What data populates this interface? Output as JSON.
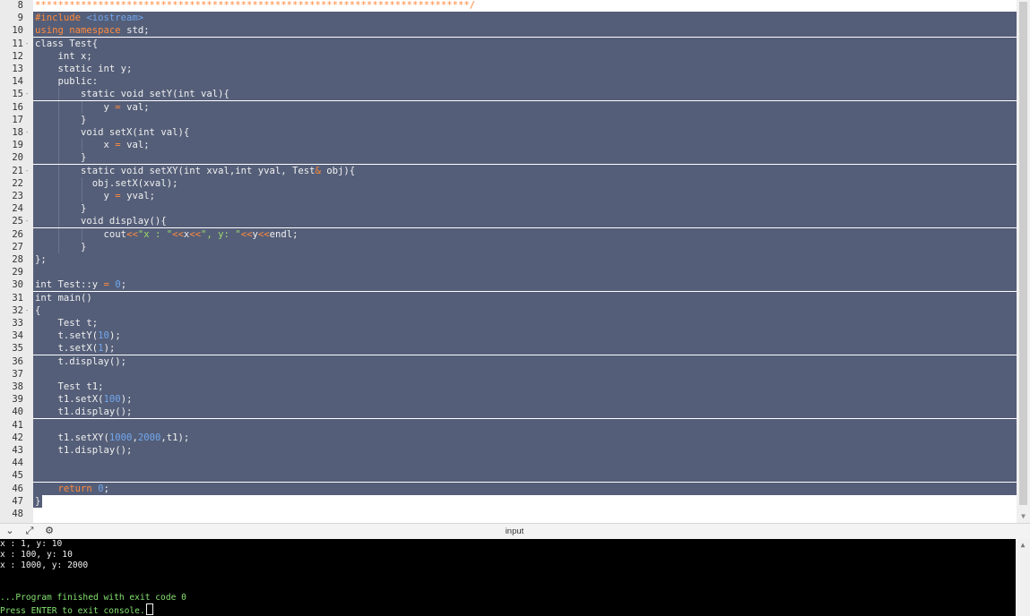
{
  "editor": {
    "lines": [
      {
        "n": "8",
        "fold": "",
        "segs": [
          {
            "t": "****************************************************************************/",
            "c": "org"
          }
        ]
      },
      {
        "n": "9",
        "fold": "",
        "segs": [
          {
            "t": "#include ",
            "c": "org"
          },
          {
            "t": "<iostream>",
            "c": "blu"
          }
        ]
      },
      {
        "n": "10",
        "fold": "",
        "segs": [
          {
            "t": "using namespace ",
            "c": "org"
          },
          {
            "t": "std;",
            "c": ""
          }
        ]
      },
      {
        "n": "11",
        "fold": "-",
        "segs": [
          {
            "t": "class Test{",
            "c": ""
          }
        ]
      },
      {
        "n": "12",
        "fold": "",
        "segs": [
          {
            "t": "    int x;",
            "c": ""
          }
        ]
      },
      {
        "n": "13",
        "fold": "",
        "segs": [
          {
            "t": "    static int y;",
            "c": ""
          }
        ]
      },
      {
        "n": "14",
        "fold": "",
        "segs": [
          {
            "t": "    public:",
            "c": ""
          }
        ]
      },
      {
        "n": "15",
        "fold": "-",
        "segs": [
          {
            "t": "        static void setY(int val){",
            "c": ""
          }
        ]
      },
      {
        "n": "16",
        "fold": "",
        "segs": [
          {
            "t": "            y ",
            "c": ""
          },
          {
            "t": "=",
            "c": "org"
          },
          {
            "t": " val;",
            "c": ""
          }
        ]
      },
      {
        "n": "17",
        "fold": "",
        "segs": [
          {
            "t": "        }",
            "c": ""
          }
        ]
      },
      {
        "n": "18",
        "fold": "-",
        "segs": [
          {
            "t": "        void setX(int val){",
            "c": ""
          }
        ]
      },
      {
        "n": "19",
        "fold": "",
        "segs": [
          {
            "t": "            x ",
            "c": ""
          },
          {
            "t": "=",
            "c": "org"
          },
          {
            "t": " val;",
            "c": ""
          }
        ]
      },
      {
        "n": "20",
        "fold": "",
        "segs": [
          {
            "t": "        }",
            "c": ""
          }
        ]
      },
      {
        "n": "21",
        "fold": "-",
        "segs": [
          {
            "t": "        static void setXY(int xval,int yval, Test",
            "c": ""
          },
          {
            "t": "&",
            "c": "org"
          },
          {
            "t": " obj){",
            "c": ""
          }
        ]
      },
      {
        "n": "22",
        "fold": "",
        "segs": [
          {
            "t": "          obj.setX(xval);",
            "c": ""
          }
        ]
      },
      {
        "n": "23",
        "fold": "",
        "segs": [
          {
            "t": "            y ",
            "c": ""
          },
          {
            "t": "=",
            "c": "org"
          },
          {
            "t": " yval;",
            "c": ""
          }
        ]
      },
      {
        "n": "24",
        "fold": "",
        "segs": [
          {
            "t": "        }",
            "c": ""
          }
        ]
      },
      {
        "n": "25",
        "fold": "-",
        "segs": [
          {
            "t": "        void display(){",
            "c": ""
          }
        ]
      },
      {
        "n": "26",
        "fold": "",
        "segs": [
          {
            "t": "            cout",
            "c": ""
          },
          {
            "t": "<<",
            "c": "org"
          },
          {
            "t": "\"x : \"",
            "c": "grn"
          },
          {
            "t": "<<",
            "c": "org"
          },
          {
            "t": "x",
            "c": ""
          },
          {
            "t": "<<",
            "c": "org"
          },
          {
            "t": "\", y: \"",
            "c": "grn"
          },
          {
            "t": "<<",
            "c": "org"
          },
          {
            "t": "y",
            "c": ""
          },
          {
            "t": "<<",
            "c": "org"
          },
          {
            "t": "endl;",
            "c": ""
          }
        ]
      },
      {
        "n": "27",
        "fold": "",
        "segs": [
          {
            "t": "        }",
            "c": ""
          }
        ]
      },
      {
        "n": "28",
        "fold": "",
        "segs": [
          {
            "t": "};",
            "c": ""
          }
        ]
      },
      {
        "n": "29",
        "fold": "",
        "segs": []
      },
      {
        "n": "30",
        "fold": "",
        "segs": [
          {
            "t": "int Test::y ",
            "c": ""
          },
          {
            "t": "=",
            "c": "org"
          },
          {
            "t": " ",
            "c": ""
          },
          {
            "t": "0",
            "c": "blu"
          },
          {
            "t": ";",
            "c": ""
          }
        ]
      },
      {
        "n": "31",
        "fold": "",
        "segs": [
          {
            "t": "int main()",
            "c": ""
          }
        ]
      },
      {
        "n": "32",
        "fold": "-",
        "segs": [
          {
            "t": "{",
            "c": ""
          }
        ]
      },
      {
        "n": "33",
        "fold": "",
        "segs": [
          {
            "t": "    Test t;",
            "c": ""
          }
        ]
      },
      {
        "n": "34",
        "fold": "",
        "segs": [
          {
            "t": "    t.setY(",
            "c": ""
          },
          {
            "t": "10",
            "c": "blu"
          },
          {
            "t": ");",
            "c": ""
          }
        ]
      },
      {
        "n": "35",
        "fold": "",
        "segs": [
          {
            "t": "    t.setX(",
            "c": ""
          },
          {
            "t": "1",
            "c": "blu"
          },
          {
            "t": ");",
            "c": ""
          }
        ]
      },
      {
        "n": "36",
        "fold": "",
        "segs": [
          {
            "t": "    t.display();",
            "c": ""
          }
        ]
      },
      {
        "n": "37",
        "fold": "",
        "segs": []
      },
      {
        "n": "38",
        "fold": "",
        "segs": [
          {
            "t": "    Test t1;",
            "c": ""
          }
        ]
      },
      {
        "n": "39",
        "fold": "",
        "segs": [
          {
            "t": "    t1.setX(",
            "c": ""
          },
          {
            "t": "100",
            "c": "blu"
          },
          {
            "t": ");",
            "c": ""
          }
        ]
      },
      {
        "n": "40",
        "fold": "",
        "segs": [
          {
            "t": "    t1.display();",
            "c": ""
          }
        ]
      },
      {
        "n": "41",
        "fold": "",
        "segs": []
      },
      {
        "n": "42",
        "fold": "",
        "segs": [
          {
            "t": "    t1.setXY(",
            "c": ""
          },
          {
            "t": "1000",
            "c": "blu"
          },
          {
            "t": ",",
            "c": ""
          },
          {
            "t": "2000",
            "c": "blu"
          },
          {
            "t": ",t1);",
            "c": ""
          }
        ]
      },
      {
        "n": "43",
        "fold": "",
        "segs": [
          {
            "t": "    t1.display();",
            "c": ""
          }
        ]
      },
      {
        "n": "44",
        "fold": "",
        "segs": []
      },
      {
        "n": "45",
        "fold": "",
        "segs": []
      },
      {
        "n": "46",
        "fold": "",
        "segs": [
          {
            "t": "    ",
            "c": ""
          },
          {
            "t": "return",
            "c": "org"
          },
          {
            "t": " ",
            "c": ""
          },
          {
            "t": "0",
            "c": "blu"
          },
          {
            "t": ";",
            "c": ""
          }
        ]
      },
      {
        "n": "47",
        "fold": "",
        "segs": [
          {
            "t": "}",
            "c": ""
          }
        ]
      },
      {
        "n": "48",
        "fold": "",
        "segs": []
      }
    ]
  },
  "splitbar": {
    "input_label": "input",
    "icons": [
      "chevron-down-icon",
      "expand-icon",
      "settings-icon"
    ]
  },
  "console": {
    "output": [
      {
        "text": "x : 1, y: 10",
        "color": "white"
      },
      {
        "text": "x : 100, y: 10",
        "color": "white"
      },
      {
        "text": "x : 1000, y: 2000",
        "color": "white"
      },
      {
        "text": "",
        "color": "white"
      },
      {
        "text": "",
        "color": "white"
      },
      {
        "text": "...Program finished with exit code 0",
        "color": "green"
      },
      {
        "text": "Press ENTER to exit console.",
        "color": "green"
      }
    ]
  },
  "colors": {
    "selection": "#545e78",
    "gutter": "#ebebeb",
    "keyword": "#ff8a3d",
    "number": "#72a7ee",
    "string": "#9ed86a",
    "console_bg": "#000000",
    "console_green": "#84e070"
  }
}
